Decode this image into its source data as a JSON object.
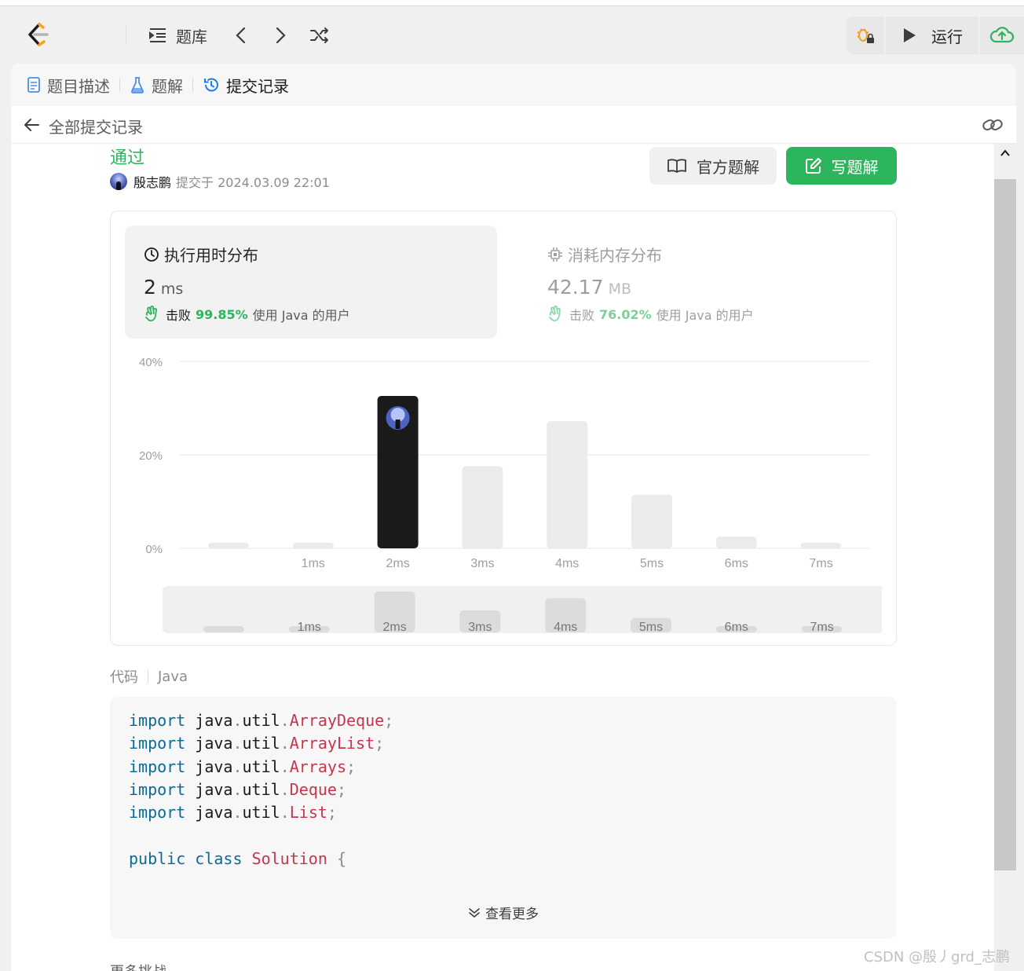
{
  "topbar": {
    "problems_label": "题库",
    "run_label": "运行"
  },
  "tabs": [
    {
      "label": "题目描述"
    },
    {
      "label": "题解"
    },
    {
      "label": "提交记录"
    }
  ],
  "subheader": {
    "title": "全部提交记录"
  },
  "submission": {
    "status": "通过",
    "author": "殷志鹏",
    "submitted_at": "提交于 2024.03.09 22:01",
    "official_solution_label": "官方题解",
    "write_solution_label": "写题解"
  },
  "runtime": {
    "title": "执行用时分布",
    "value": "2",
    "unit": "ms",
    "beat_word": "击败",
    "beat_percent": "99.85%",
    "beat_rest": "使用 Java 的用户"
  },
  "memory": {
    "title": "消耗内存分布",
    "value": "42.17",
    "unit": "MB",
    "beat_word": "击败",
    "beat_percent": "76.02%",
    "beat_rest": "使用 Java 的用户"
  },
  "chart_data": {
    "type": "bar",
    "categories": [
      "",
      "1ms",
      "2ms",
      "3ms",
      "4ms",
      "5ms",
      "6ms",
      "7ms"
    ],
    "values": [
      1.2,
      1.2,
      32.6,
      17.6,
      27.2,
      11.5,
      2.5,
      1.2
    ],
    "highlight_index": 2,
    "yticks": [
      "40%",
      "20%",
      "0%"
    ],
    "ylim": [
      0,
      40
    ],
    "grid": true,
    "minimap_labels": [
      "",
      "1ms",
      "2ms",
      "3ms",
      "4ms",
      "5ms",
      "6ms",
      "7ms"
    ]
  },
  "code": {
    "label": "代码",
    "language": "Java",
    "lines": [
      [
        {
          "t": "import",
          "c": "kw"
        },
        {
          "t": " java"
        },
        {
          "t": ".",
          "c": "pn"
        },
        {
          "t": "util"
        },
        {
          "t": ".",
          "c": "pn"
        },
        {
          "t": "ArrayDeque",
          "c": "ty"
        },
        {
          "t": ";",
          "c": "pn"
        }
      ],
      [
        {
          "t": "import",
          "c": "kw"
        },
        {
          "t": " java"
        },
        {
          "t": ".",
          "c": "pn"
        },
        {
          "t": "util"
        },
        {
          "t": ".",
          "c": "pn"
        },
        {
          "t": "ArrayList",
          "c": "ty"
        },
        {
          "t": ";",
          "c": "pn"
        }
      ],
      [
        {
          "t": "import",
          "c": "kw"
        },
        {
          "t": " java"
        },
        {
          "t": ".",
          "c": "pn"
        },
        {
          "t": "util"
        },
        {
          "t": ".",
          "c": "pn"
        },
        {
          "t": "Arrays",
          "c": "ty"
        },
        {
          "t": ";",
          "c": "pn"
        }
      ],
      [
        {
          "t": "import",
          "c": "kw"
        },
        {
          "t": " java"
        },
        {
          "t": ".",
          "c": "pn"
        },
        {
          "t": "util"
        },
        {
          "t": ".",
          "c": "pn"
        },
        {
          "t": "Deque",
          "c": "ty"
        },
        {
          "t": ";",
          "c": "pn"
        }
      ],
      [
        {
          "t": "import",
          "c": "kw"
        },
        {
          "t": " java"
        },
        {
          "t": ".",
          "c": "pn"
        },
        {
          "t": "util"
        },
        {
          "t": ".",
          "c": "pn"
        },
        {
          "t": "List",
          "c": "ty"
        },
        {
          "t": ";",
          "c": "pn"
        }
      ],
      [],
      [
        {
          "t": "public",
          "c": "kw"
        },
        {
          "t": " "
        },
        {
          "t": "class",
          "c": "kw"
        },
        {
          "t": " "
        },
        {
          "t": "Solution",
          "c": "ty"
        },
        {
          "t": " "
        },
        {
          "t": "{",
          "c": "pn"
        }
      ]
    ],
    "show_more": "查看更多"
  },
  "more_challenges": "更多挑战",
  "watermark": "CSDN @殷丿grd_志鹏",
  "colors": {
    "accent_green": "#2db55d",
    "highlight_bar": "#1a1a1a",
    "bar": "#ebebeb"
  }
}
